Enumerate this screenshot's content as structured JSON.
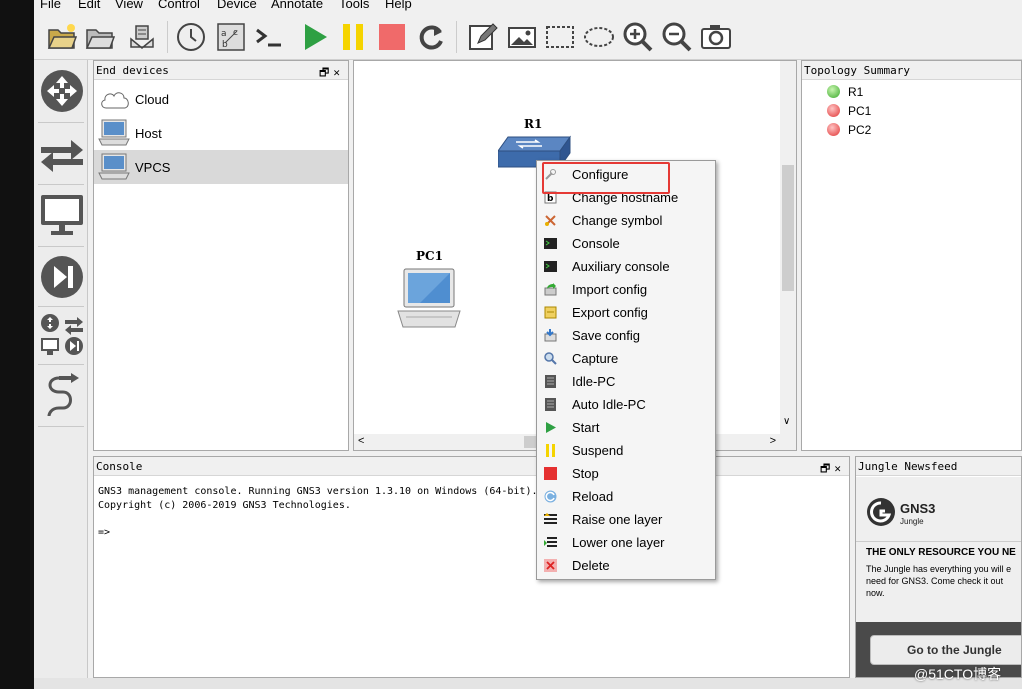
{
  "menu": [
    "File",
    "Edit",
    "View",
    "Control",
    "Device",
    "Annotate",
    "Tools",
    "Help"
  ],
  "toolbar_icons": [
    "open-project-icon",
    "open-folder-icon",
    "snapshot-icon",
    "clock-icon",
    "show-interface-labels-icon",
    "console-all-icon",
    "start-all-icon",
    "suspend-all-icon",
    "stop-all-icon",
    "reload-all-icon",
    "add-note-icon",
    "insert-image-icon",
    "draw-rectangle-icon",
    "draw-ellipse-icon",
    "zoom-in-icon",
    "zoom-out-icon",
    "screenshot-icon"
  ],
  "colors": {
    "start": "#2ea043",
    "suspend": "#f5d400",
    "stop": "#f06a6a",
    "highlight": "#e53935"
  },
  "end_devices": {
    "title": "End devices",
    "items": [
      {
        "label": "Cloud"
      },
      {
        "label": "Host"
      },
      {
        "label": "VPCS"
      }
    ]
  },
  "canvas": {
    "nodes": [
      {
        "label": "R1"
      },
      {
        "label": "PC1"
      }
    ]
  },
  "topology": {
    "title": "Topology Summary",
    "items": [
      {
        "label": "R1",
        "status": "green"
      },
      {
        "label": "PC1",
        "status": "red"
      },
      {
        "label": "PC2",
        "status": "red"
      }
    ]
  },
  "console": {
    "title": "Console",
    "line1": "GNS3 management console. Running GNS3 version 1.3.10 on Windows (64-bit).",
    "line2": "Copyright (c) 2006-2019 GNS3 Technologies.",
    "prompt": "=>"
  },
  "newsfeed": {
    "title": "Jungle Newsfeed",
    "logo_text": "GNS3",
    "logo_sub": "Jungle",
    "headline": "THE ONLY RESOURCE YOU NE",
    "body1": "The Jungle has everything you will e",
    "body2": "need for GNS3. Come check it out",
    "body3": "now.",
    "button": "Go to the Jungle"
  },
  "context_menu": [
    "Configure",
    "Change hostname",
    "Change symbol",
    "Console",
    "Auxiliary console",
    "Import config",
    "Export config",
    "Save config",
    "Capture",
    "Idle-PC",
    "Auto Idle-PC",
    "Start",
    "Suspend",
    "Stop",
    "Reload",
    "Raise one layer",
    "Lower one layer",
    "Delete"
  ],
  "watermark": "@51CTO博客"
}
